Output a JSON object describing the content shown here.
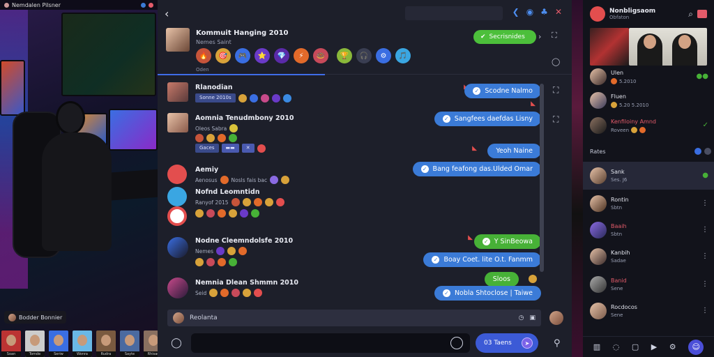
{
  "left_panel": {
    "topbar_title": "Nemdalen Pilsner",
    "viewer_label": "Bodder Bonnier",
    "viewers": [
      "Soan",
      "Tomde",
      "Seriw",
      "Wonra",
      "Rudra",
      "Sayte",
      "Rhisad"
    ]
  },
  "chat": {
    "header": {
      "name": "Kommuit Hanging 2010",
      "subtitle": "Nemes Saint",
      "sub2": "Oden",
      "pill": "Secrisnides",
      "reactions": [
        "🔥",
        "🎯",
        "🎮",
        "⭐",
        "💎",
        "⚡",
        "🍩",
        "🏆",
        "🎧",
        "⚙",
        "🎵"
      ]
    },
    "messages_left": [
      {
        "name": "Rlanodian",
        "line1_pill": "Sonne 2010s",
        "line1": ""
      },
      {
        "name": "Aomnia Tenudmbony 2010",
        "line1": "Oleos Sabra",
        "line2_pill": "Gaces"
      },
      {
        "name": "Aemiy",
        "line1": "Aenosus",
        "line1b": "Nosls fais bac"
      },
      {
        "name": "Nofnd Leomntidn",
        "line1": "Ranyof 2015",
        "line2": ""
      },
      {
        "name": "Nodne Cleemndolsfe 2010",
        "line1": "Nemes"
      },
      {
        "name": "Nemnia Dlean Shmmn 2010",
        "line1": "Seid"
      }
    ],
    "messages_right": [
      {
        "text": "Scodne Nalmo",
        "color": "blue"
      },
      {
        "text": "Sangfees daefdas Lisny",
        "color": "blue"
      },
      {
        "text": "Yeoh Naine",
        "color": "blue"
      },
      {
        "text": "Bang feafong das.Ulded Omar",
        "color": "blue"
      },
      {
        "text": "Y SinBeowa",
        "color": "green"
      },
      {
        "text": "Boay Coet. lite O.t. Fanmm",
        "color": "blue"
      },
      {
        "text": "Sloos",
        "color": "green"
      },
      {
        "text": "Nobla Shtoclose | Taiwe",
        "color": "blue"
      }
    ],
    "reply_text": "Reolanta",
    "compose_placeholder": "",
    "send_label": "03 Taens"
  },
  "right_panel": {
    "title": "Nonbligsaom",
    "subtitle": "Obfaton",
    "online": [
      {
        "name": "Ulen",
        "status": "5.2010"
      },
      {
        "name": "Fluen",
        "status": "5.20 5.2010"
      },
      {
        "name": "Kenfiloiny Amnd",
        "status": "Roveen"
      }
    ],
    "section_title": "Rates",
    "members": [
      {
        "name": "Sank",
        "status": "Ses. J6"
      },
      {
        "name": "Rontin",
        "status": "Sbtn"
      },
      {
        "name": "Baaih",
        "status": "Sbtn"
      },
      {
        "name": "Kanbih",
        "status": "Sadae"
      },
      {
        "name": "Banid",
        "status": "Sene"
      },
      {
        "name": "Rocdocos",
        "status": "Sene"
      }
    ]
  }
}
